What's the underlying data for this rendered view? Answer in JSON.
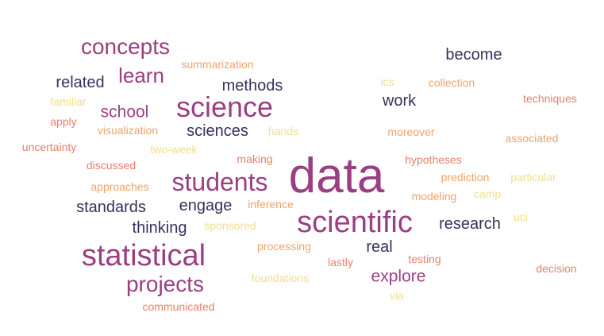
{
  "palette": {
    "purple": "#9b3f83",
    "navy": "#3b2f5e",
    "salmon": "#e8806a",
    "orange": "#eea36a",
    "yellow": "#f2dd92"
  },
  "words": [
    {
      "text": "data",
      "color": "#9b3f83"
    },
    {
      "text": "scientific",
      "color": "#9b3f83"
    },
    {
      "text": "statistical",
      "color": "#9b3f83"
    },
    {
      "text": "science",
      "color": "#9b3f83"
    },
    {
      "text": "students",
      "color": "#9b3f83"
    },
    {
      "text": "concepts",
      "color": "#9b3f83"
    },
    {
      "text": "projects",
      "color": "#9b3f83"
    },
    {
      "text": "learn",
      "color": "#9b3f83"
    },
    {
      "text": "school",
      "color": "#9b3f83"
    },
    {
      "text": "explore",
      "color": "#9b3f83"
    },
    {
      "text": "become",
      "color": "#3b2f5e"
    },
    {
      "text": "related",
      "color": "#3b2f5e"
    },
    {
      "text": "methods",
      "color": "#3b2f5e"
    },
    {
      "text": "work",
      "color": "#3b2f5e"
    },
    {
      "text": "sciences",
      "color": "#3b2f5e"
    },
    {
      "text": "standards",
      "color": "#3b2f5e"
    },
    {
      "text": "engage",
      "color": "#3b2f5e"
    },
    {
      "text": "thinking",
      "color": "#3b2f5e"
    },
    {
      "text": "research",
      "color": "#3b2f5e"
    },
    {
      "text": "real",
      "color": "#3b2f5e"
    },
    {
      "text": "summarization",
      "color": "#eea36a"
    },
    {
      "text": "collection",
      "color": "#eea36a"
    },
    {
      "text": "techniques",
      "color": "#e8806a"
    },
    {
      "text": "ics",
      "color": "#f2dd92"
    },
    {
      "text": "familiar",
      "color": "#f2dd92"
    },
    {
      "text": "apply",
      "color": "#e8806a"
    },
    {
      "text": "visualization",
      "color": "#eea36a"
    },
    {
      "text": "hands",
      "color": "#f2dd92"
    },
    {
      "text": "moreover",
      "color": "#eea36a"
    },
    {
      "text": "associated",
      "color": "#eea36a"
    },
    {
      "text": "uncertainty",
      "color": "#e8806a"
    },
    {
      "text": "two-week",
      "color": "#f2dd92"
    },
    {
      "text": "making",
      "color": "#e8806a"
    },
    {
      "text": "hypotheses",
      "color": "#e8806a"
    },
    {
      "text": "discussed",
      "color": "#e8806a"
    },
    {
      "text": "prediction",
      "color": "#eea36a"
    },
    {
      "text": "particular",
      "color": "#f2dd92"
    },
    {
      "text": "approaches",
      "color": "#eea36a"
    },
    {
      "text": "modeling",
      "color": "#eea36a"
    },
    {
      "text": "camp",
      "color": "#f2dd92"
    },
    {
      "text": "inference",
      "color": "#eea36a"
    },
    {
      "text": "uci",
      "color": "#f2dd92"
    },
    {
      "text": "sponsored",
      "color": "#f2dd92"
    },
    {
      "text": "processing",
      "color": "#eea36a"
    },
    {
      "text": "testing",
      "color": "#e8806a"
    },
    {
      "text": "lastly",
      "color": "#e8806a"
    },
    {
      "text": "decision",
      "color": "#e8806a"
    },
    {
      "text": "foundations",
      "color": "#f2dd92"
    },
    {
      "text": "via",
      "color": "#f2dd92"
    },
    {
      "text": "communicated",
      "color": "#e8806a"
    }
  ]
}
